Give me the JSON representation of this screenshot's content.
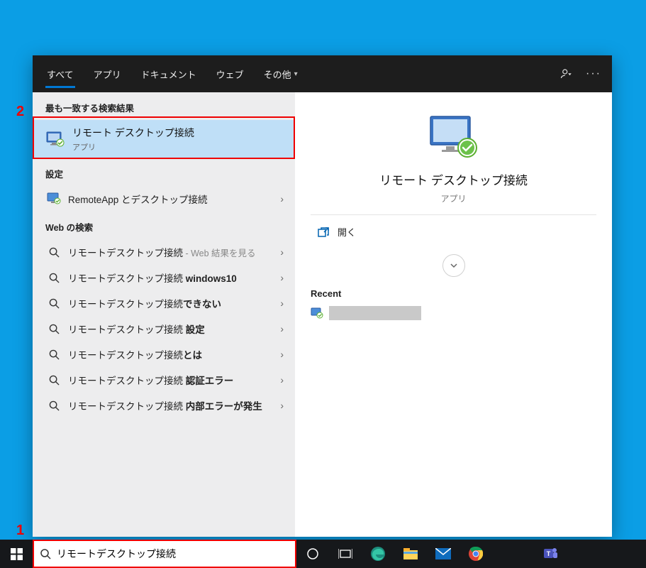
{
  "annotations": {
    "one": "1",
    "two": "2"
  },
  "tabs": {
    "all": "すべて",
    "apps": "アプリ",
    "documents": "ドキュメント",
    "web": "ウェブ",
    "more": "その他"
  },
  "left": {
    "bestMatchHeader": "最も一致する検索結果",
    "bestMatch": {
      "title": "リモート デスクトップ接続",
      "sub": "アプリ"
    },
    "settingsHeader": "設定",
    "settingsItem": "RemoteApp とデスクトップ接続",
    "webHeader": "Web の検索",
    "web": [
      {
        "text": "リモートデスクトップ接続",
        "suffix": " - Web 結果を見る"
      },
      {
        "text": "リモートデスクトップ接続 ",
        "bold": "windows10"
      },
      {
        "text": "リモートデスクトップ接続",
        "bold": "できない"
      },
      {
        "text": "リモートデスクトップ接続 ",
        "bold": "設定"
      },
      {
        "text": "リモートデスクトップ接続",
        "bold": "とは"
      },
      {
        "text": "リモートデスクトップ接続 ",
        "bold": "認証エラー"
      },
      {
        "text": "リモートデスクトップ接続 ",
        "bold": "内部エラーが発生"
      }
    ]
  },
  "right": {
    "title": "リモート デスクトップ接続",
    "sub": "アプリ",
    "open": "開く",
    "recentHeader": "Recent"
  },
  "search": {
    "value": "リモートデスクトップ接続"
  }
}
